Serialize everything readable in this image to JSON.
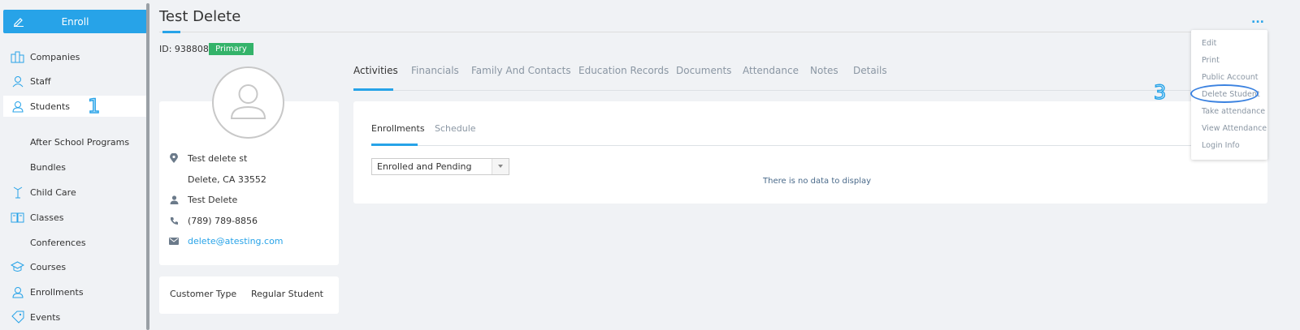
{
  "sidebar": {
    "enroll_label": "Enroll",
    "items": [
      {
        "label": "Companies",
        "icon": "building-icon"
      },
      {
        "label": "Staff",
        "icon": "staff-icon"
      },
      {
        "label": "Students",
        "icon": "user-icon",
        "active": true
      },
      {
        "label": "After School Programs",
        "icon": ""
      },
      {
        "label": "Bundles",
        "icon": ""
      },
      {
        "label": "Child Care",
        "icon": "child-care-icon"
      },
      {
        "label": "Classes",
        "icon": "book-icon"
      },
      {
        "label": "Conferences",
        "icon": ""
      },
      {
        "label": "Courses",
        "icon": "graduation-cap-icon"
      },
      {
        "label": "Enrollments",
        "icon": "user-icon"
      },
      {
        "label": "Events",
        "icon": "tag-icon"
      }
    ],
    "annotation": "1"
  },
  "header": {
    "title": "Test Delete",
    "more_label": "..."
  },
  "student": {
    "id_text": "ID: 9388087",
    "badge": "Primary",
    "address1": "Test delete st",
    "address2": "Delete, CA 33552",
    "name": "Test Delete",
    "phone": "(789) 789-8856",
    "email": "delete@atesting.com",
    "customer_type_label": "Customer Type",
    "customer_type_value": "Regular Student"
  },
  "tabs": [
    "Activities",
    "Financials",
    "Family And Contacts",
    "Education Records",
    "Documents",
    "Attendance",
    "Notes",
    "Details"
  ],
  "subtabs": [
    "Enrollments",
    "Schedule"
  ],
  "filter": {
    "selected": "Enrolled and Pending"
  },
  "empty_message": "There is no data to display",
  "menu": {
    "items": [
      "Edit",
      "Print",
      "Public Account",
      "Delete Student",
      "Take attendance",
      "View Attendance",
      "Login Info"
    ],
    "highlighted": "Delete Student",
    "annotation": "3"
  },
  "colors": {
    "accent": "#27a3e8",
    "badge": "#34b36a",
    "background": "#f0f2f5"
  }
}
